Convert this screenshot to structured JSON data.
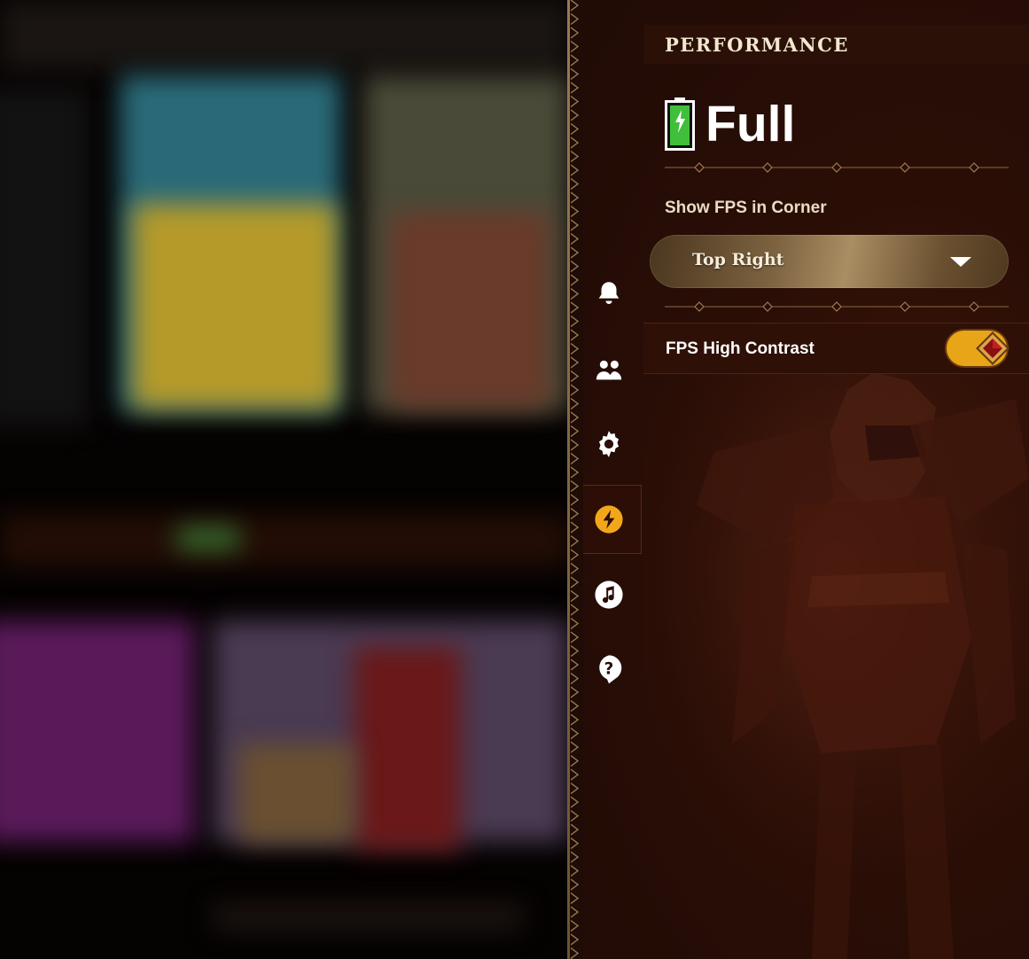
{
  "panel": {
    "title": "PERFORMANCE",
    "performance_mode": "Full",
    "battery_icon": "battery-charging-icon",
    "fps_corner": {
      "label": "Show FPS in Corner",
      "selected": "Top Right"
    },
    "fps_high_contrast": {
      "label": "FPS High Contrast",
      "enabled": true
    }
  },
  "nav": {
    "items": [
      {
        "icon": "bell-icon",
        "active": false
      },
      {
        "icon": "friends-icon",
        "active": false
      },
      {
        "icon": "gear-icon",
        "active": false
      },
      {
        "icon": "lightning-icon",
        "active": true
      },
      {
        "icon": "music-icon",
        "active": false
      },
      {
        "icon": "help-icon",
        "active": false
      }
    ]
  },
  "colors": {
    "panel_bg": "#2a0e06",
    "accent": "#f2a71b",
    "toggle_on": "#e9a518",
    "gold": "#a98d63",
    "battery_green": "#3fbf3a"
  }
}
